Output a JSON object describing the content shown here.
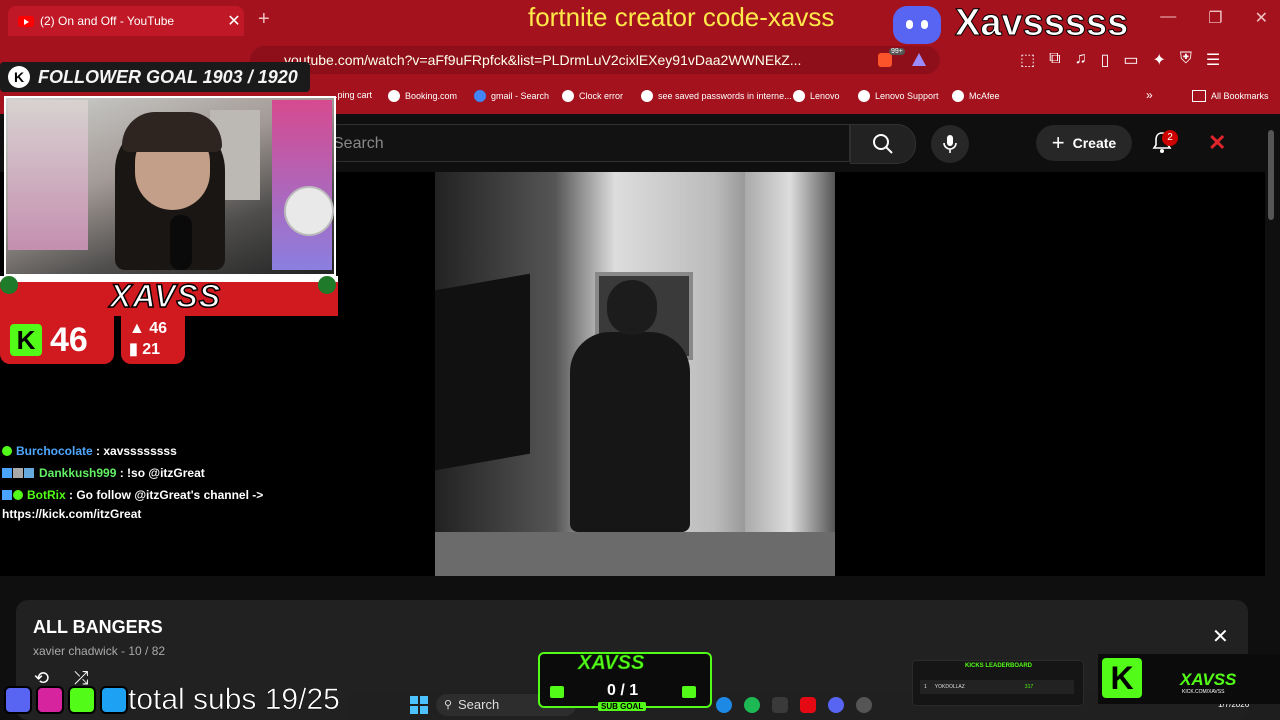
{
  "browser": {
    "tab_title": "(2) On and Off - YouTube",
    "url": "youtube.com/watch?v=aFf9uFRpfck&list=PLDrmLuV2cixlEXey91vDaa2WWNEkZ...",
    "new_tab_glyph": "+",
    "tab_close_glyph": "✕",
    "bookmarks": [
      {
        "label": "...ping cart"
      },
      {
        "label": "Booking.com"
      },
      {
        "label": "gmail - Search"
      },
      {
        "label": "Clock error"
      },
      {
        "label": "see saved passwords in interne..."
      },
      {
        "label": "Lenovo"
      },
      {
        "label": "Lenovo Support"
      },
      {
        "label": "McAfee"
      }
    ],
    "all_bookmarks": "All Bookmarks",
    "more_bookmarks_glyph": "»",
    "brave_badge": "99+"
  },
  "youtube": {
    "search_placeholder": "Search",
    "create_label": "Create",
    "notification_count": "2"
  },
  "playlist": {
    "title": "ALL BANGERS",
    "subtitle": "xavier chadwick - 10 / 82",
    "close_glyph": "✕"
  },
  "overlay": {
    "creator_code": "fortnite creator code-xavss",
    "display_name": "Xavsssss",
    "follower_goal": "FOLLOWER GOAL 1903 / 1920",
    "follower_k": "K",
    "xavss_label": "XAVSS",
    "kick_viewers": "46",
    "kick_k": "K",
    "stat_a": "▲ 46",
    "stat_b": "▮ 21",
    "chat": [
      {
        "user": "Burchocolate",
        "message": " : xavssssssss"
      },
      {
        "user": "Dankkush999",
        "message": " : !so @itzGreat"
      },
      {
        "user": "BotRix",
        "message": " : Go follow @itzGreat's channel ->"
      }
    ],
    "chat_link": "https://kick.com/itzGreat",
    "total_subs": "total subs 19/25",
    "sub_goal_title": "XAVSS",
    "sub_goal_count": "0 / 1",
    "sub_goal_label": "SUB GOAL",
    "leaderboard_title": "KICKS LEADERBOARD",
    "leaderboard_entry": "YOKDOLLAZ",
    "leaderboard_rank": "1",
    "leaderboard_value": "317",
    "brand_name": "XAVSS",
    "brand_url": "KICK.COM/XAVSS"
  },
  "taskbar": {
    "search_label": "Search",
    "date": "1/7/2026"
  },
  "colors": {
    "browser_red": "#a3121d",
    "kick_green": "#53fc18",
    "overlay_yellow": "#ffe94a",
    "discord": "#5865f2"
  }
}
